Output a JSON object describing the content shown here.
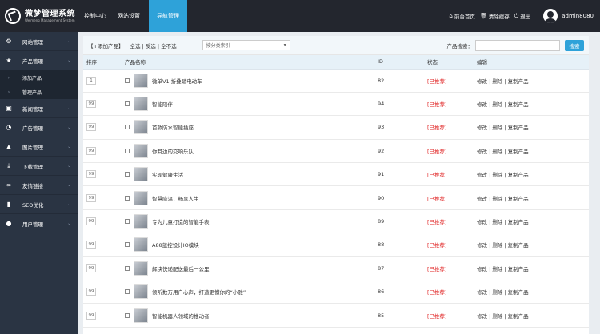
{
  "app": {
    "title": "微梦管理系统",
    "subtitle": "Weimeng Management System"
  },
  "topnav": [
    "控制中心",
    "网站设置",
    "导航管理"
  ],
  "topright": {
    "home": "前台首页",
    "clear": "清除缓存",
    "logout": "退出",
    "user": "admin8080"
  },
  "sidebar": {
    "items": [
      {
        "label": "网站管理",
        "icon": "gear-icon"
      },
      {
        "label": "产品管理",
        "icon": "star-icon"
      },
      {
        "label": "新闻管理",
        "icon": "news-icon"
      },
      {
        "label": "广告管理",
        "icon": "pie-icon"
      },
      {
        "label": "图片管理",
        "icon": "image-icon"
      },
      {
        "label": "下载管理",
        "icon": "download-icon"
      },
      {
        "label": "友情链接",
        "icon": "link-icon"
      },
      {
        "label": "SEO优化",
        "icon": "bar-chart-icon"
      },
      {
        "label": "用户管理",
        "icon": "user-icon"
      }
    ],
    "sub": [
      "添加产品",
      "管理产品"
    ]
  },
  "toolbar": {
    "add": "【+添加产品】",
    "select_all": "全选",
    "invert": "反选",
    "select_none": "全不选",
    "category": "按分类索引",
    "search_label": "产品搜索：",
    "search_button": "搜索"
  },
  "table": {
    "headers": [
      "排序",
      "产品名称",
      "ID",
      "状态",
      "编辑"
    ],
    "edit_text": "修改 | 删除 | 复制产品",
    "status_text": "[已推荐]",
    "rows": [
      {
        "sort": "1",
        "name": "微单V1 折叠踏电动车",
        "id": "82"
      },
      {
        "sort": "99",
        "name": "智能陪伴",
        "id": "94"
      },
      {
        "sort": "99",
        "name": "首款防水智能插座",
        "id": "93"
      },
      {
        "sort": "99",
        "name": "你耳边的交响乐队",
        "id": "92"
      },
      {
        "sort": "99",
        "name": "实现健康生活",
        "id": "91"
      },
      {
        "sort": "99",
        "name": "智慧降温，畅享人生",
        "id": "90"
      },
      {
        "sort": "99",
        "name": "专为儿童打造的智能手表",
        "id": "89"
      },
      {
        "sort": "99",
        "name": "A88蓝控设计IO模块",
        "id": "88"
      },
      {
        "sort": "99",
        "name": "解决快递配送最后一公里",
        "id": "87"
      },
      {
        "sort": "99",
        "name": "倾听数万用户心声，打造更懂你的“小雅”",
        "id": "86"
      },
      {
        "sort": "99",
        "name": "智能机器人领域的推动者",
        "id": "85"
      }
    ]
  }
}
